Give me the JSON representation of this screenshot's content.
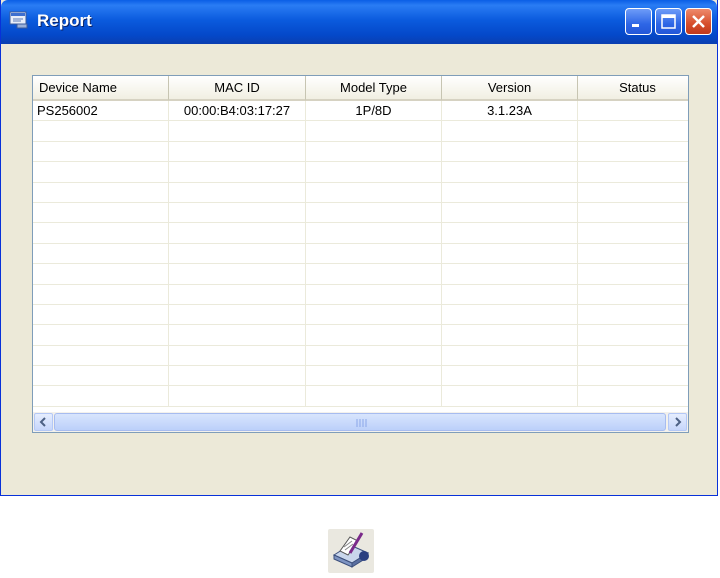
{
  "window": {
    "title": "Report",
    "title_icon": "report-window-icon",
    "controls": [
      "minimize-icon",
      "maximize-icon",
      "close-icon"
    ]
  },
  "table": {
    "columns": [
      "Device Name",
      "MAC ID",
      "Model Type",
      "Version",
      "Status"
    ],
    "rows": [
      [
        "PS256002",
        "00:00:B4:03:17:27",
        "1P/8D",
        "3.1.23A",
        ""
      ]
    ],
    "empty_row_count": 14
  },
  "scrollbar": {
    "left_icon": "scroll-left-icon",
    "right_icon": "scroll-right-icon"
  },
  "bottom_icon": "print-report-tool-icon",
  "colors": {
    "titlebar": "#0b5bde",
    "window_bg": "#ece9d8",
    "close_button": "#d64e2c"
  }
}
